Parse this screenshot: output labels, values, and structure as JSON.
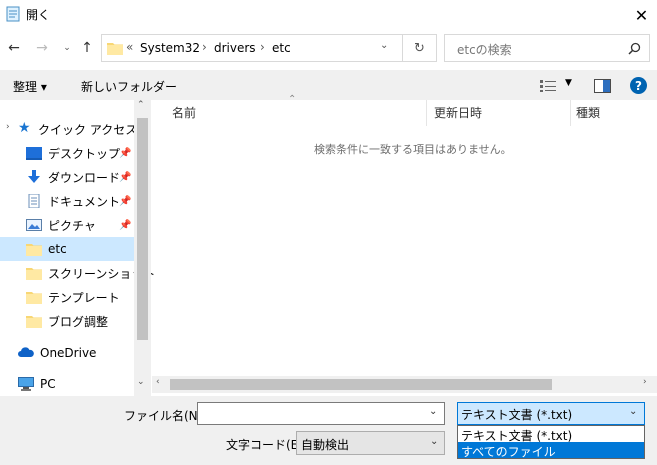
{
  "window": {
    "title": "開く",
    "close": "✕"
  },
  "nav": {
    "path_prefix": "«",
    "breadcrumb": [
      "System32",
      "drivers",
      "etc"
    ],
    "separator": "›",
    "search_placeholder": "etcの検索"
  },
  "toolbar": {
    "organize": "整理 ▾",
    "new_folder": "新しいフォルダー"
  },
  "sidebar": {
    "quick_access": "クイック アクセス",
    "items": [
      {
        "label": "デスクトップ",
        "icon": "desktop-icon",
        "pinned": true
      },
      {
        "label": "ダウンロード",
        "icon": "download-icon",
        "pinned": true
      },
      {
        "label": "ドキュメント",
        "icon": "document-icon",
        "pinned": true
      },
      {
        "label": "ピクチャ",
        "icon": "picture-icon",
        "pinned": true
      },
      {
        "label": "etc",
        "icon": "folder-icon",
        "pinned": false,
        "selected": true
      },
      {
        "label": "スクリーンショット",
        "icon": "folder-icon",
        "pinned": false
      },
      {
        "label": "テンプレート",
        "icon": "folder-icon",
        "pinned": false
      },
      {
        "label": "ブログ調整",
        "icon": "folder-icon",
        "pinned": false
      }
    ],
    "onedrive": "OneDrive",
    "pc": "PC"
  },
  "content": {
    "columns": [
      "名前",
      "更新日時",
      "種類"
    ],
    "empty_message": "検索条件に一致する項目はありません。"
  },
  "footer": {
    "filename_label": "ファイル名(N):",
    "filename_value": "",
    "filetype_selected": "テキスト文書 (*.txt)",
    "filetype_options": [
      "テキスト文書 (*.txt)",
      "すべてのファイル"
    ],
    "encoding_label": "文字コード(E):",
    "encoding_value": "自動検出"
  },
  "colors": {
    "selection": "#cce8ff",
    "dropdown_highlight": "#0078d7",
    "help": "#0063b1"
  }
}
